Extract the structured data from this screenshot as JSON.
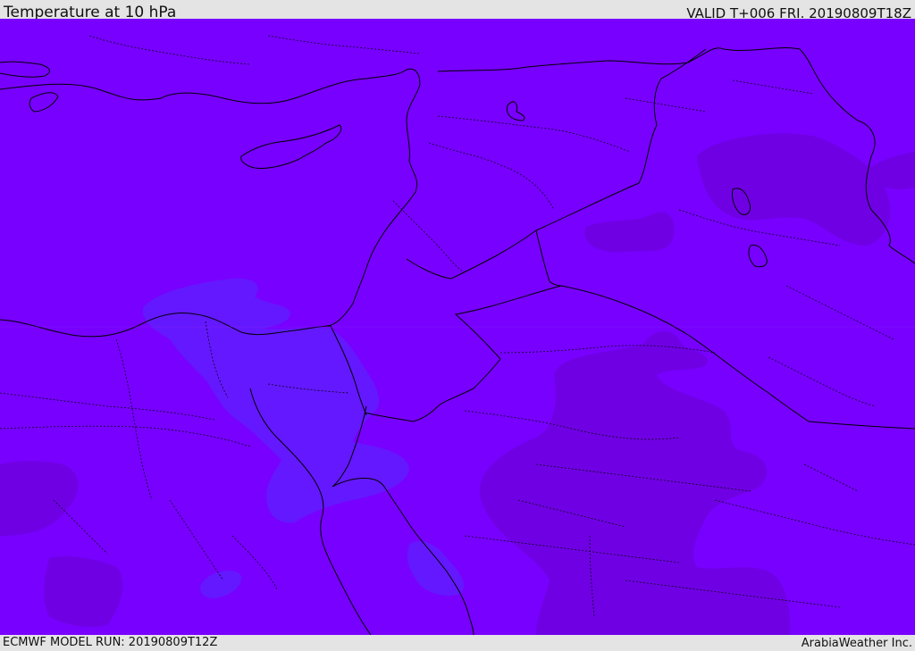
{
  "header": {
    "title": "Temperature at 10 hPa",
    "valid_time": "VALID T+006 FRI. 20190809T18Z"
  },
  "footer": {
    "model_run": "ECMWF MODEL RUN: 20190809T12Z",
    "credit": "ArabiaWeather Inc."
  },
  "colors": {
    "base_field": "#7800ff",
    "warm_field": "#7000e0",
    "cool_field": "#6418ff",
    "coastline": "#000000"
  }
}
